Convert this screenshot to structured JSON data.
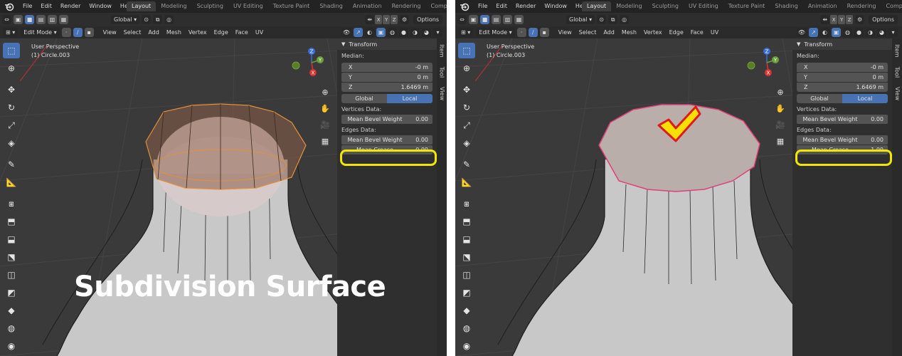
{
  "menu": [
    "File",
    "Edit",
    "Render",
    "Window",
    "Help"
  ],
  "workspace_tabs": [
    "Layout",
    "Modeling",
    "Sculpting",
    "UV Editing",
    "Texture Paint",
    "Shading",
    "Animation",
    "Rendering",
    "Compositing"
  ],
  "header": {
    "orientation": "Global",
    "axes": [
      "X",
      "Y",
      "Z"
    ],
    "options": "Options",
    "mode": "Edit Mode",
    "menus": [
      "View",
      "Select",
      "Add",
      "Mesh",
      "Vertex",
      "Edge",
      "Face",
      "UV"
    ]
  },
  "viewport": {
    "perspective": "User Perspective",
    "object": "(1) Circle.003"
  },
  "npanel": {
    "section": "Transform",
    "median_label": "Median:",
    "x_label": "X",
    "x_value": "-0 m",
    "y_label": "Y",
    "y_value": "0 m",
    "z_label": "Z",
    "z_value": "1.6469 m",
    "global_label": "Global",
    "local_label": "Local",
    "vertices_data_label": "Vertices Data:",
    "edges_data_label": "Edges Data:",
    "mean_bevel_weight_label": "Mean Bevel Weight",
    "mean_crease_label": "Mean Crease",
    "vertex_bevel_value": "0.00",
    "tabs": [
      "Item",
      "Tool",
      "View"
    ]
  },
  "left_panel": {
    "edge_bevel_value": "0.00",
    "mean_crease_value": "0.00",
    "caption": "Subdivision Surface"
  },
  "right_panel": {
    "edge_bevel_value": "0.00",
    "mean_crease_value": "1.00"
  },
  "colors": {
    "highlight": "#f2e600",
    "accent": "#4772b3",
    "check_fill": "#f7e000",
    "check_stroke": "#e01a1a"
  }
}
